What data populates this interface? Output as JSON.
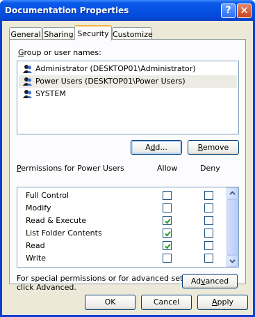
{
  "window": {
    "title": "Documentation Properties",
    "help_glyph": "?",
    "close_glyph": "✕"
  },
  "tabs": [
    {
      "label": "General"
    },
    {
      "label": "Sharing"
    },
    {
      "label": "Security",
      "active": true
    },
    {
      "label": "Customize"
    }
  ],
  "security": {
    "group_label": {
      "underlined": "G",
      "rest": "roup or user names:"
    },
    "users": [
      {
        "name": "Administrator (DESKTOP01\\Administrator)",
        "selected": false
      },
      {
        "name": "Power Users (DESKTOP01\\Power Users)",
        "selected": true
      },
      {
        "name": "SYSTEM",
        "selected": false
      }
    ],
    "add_button": {
      "underlined": "d",
      "pre": "A",
      "post": "d..."
    },
    "remove_button": {
      "underlined": "R",
      "rest": "emove"
    },
    "permissions_label": {
      "underlined": "P",
      "rest": "ermissions for Power Users"
    },
    "allow_header": "Allow",
    "deny_header": "Deny",
    "permissions": [
      {
        "name": "Full Control",
        "allow": false,
        "deny": false
      },
      {
        "name": "Modify",
        "allow": false,
        "deny": false
      },
      {
        "name": "Read & Execute",
        "allow": true,
        "deny": false
      },
      {
        "name": "List Folder Contents",
        "allow": true,
        "deny": false
      },
      {
        "name": "Read",
        "allow": true,
        "deny": false
      },
      {
        "name": "Write",
        "allow": false,
        "deny": false
      }
    ],
    "advanced_text_1": "For special permissions or for advanced settings,",
    "advanced_text_2": "click Advanced.",
    "advanced_button": {
      "pre": "Ad",
      "underlined": "v",
      "post": "anced"
    }
  },
  "footer": {
    "ok": "OK",
    "cancel": "Cancel",
    "apply": {
      "underlined": "A",
      "rest": "pply"
    }
  },
  "colors": {
    "title_blue": "#0651e3",
    "dialog_bg": "#ece9d8",
    "check_green": "#21a121"
  },
  "icons": {
    "user": "users-icon",
    "scroll_up": "chevron-up-icon",
    "scroll_down": "chevron-down-icon"
  }
}
